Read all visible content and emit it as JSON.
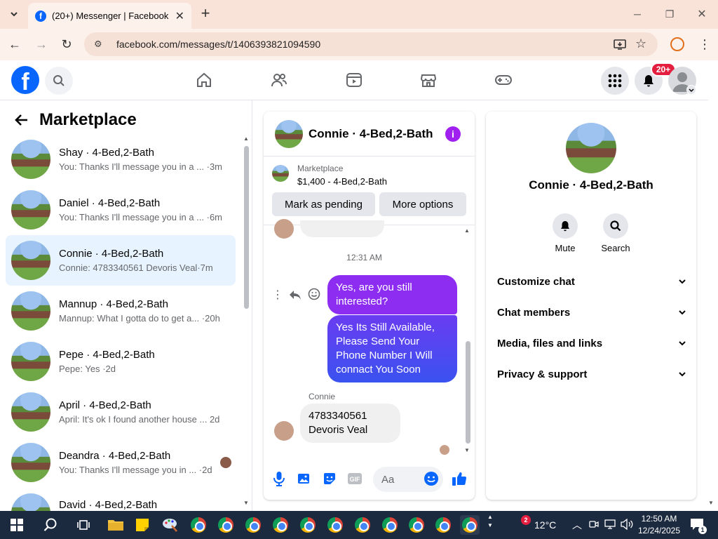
{
  "browser": {
    "tab_title": "(20+) Messenger | Facebook",
    "url": "facebook.com/messages/t/1406393821094590"
  },
  "fb_header": {
    "notif_badge": "20+"
  },
  "sidebar": {
    "title": "Marketplace",
    "conversations": [
      {
        "name": "Shay · 4-Bed,2-Bath",
        "preview": "You: Thanks I'll message you in a ...",
        "time": "·3m"
      },
      {
        "name": "Daniel · 4-Bed,2-Bath",
        "preview": "You: Thanks I'll message you in a ...",
        "time": "·6m"
      },
      {
        "name": "Connie · 4-Bed,2-Bath",
        "preview": "Connie: 4783340561 Devoris Veal",
        "time": "·7m",
        "active": true
      },
      {
        "name": "Mannup · 4-Bed,2-Bath",
        "preview": "Mannup: What I gotta do to get a...",
        "time": "·20h"
      },
      {
        "name": "Pepe · 4-Bed,2-Bath",
        "preview": "Pepe: Yes",
        "time": "·2d"
      },
      {
        "name": "April · 4-Bed,2-Bath",
        "preview": "April: It's ok I found another house ...",
        "time": "2d"
      },
      {
        "name": "Deandra · 4-Bed,2-Bath",
        "preview": "You: Thanks I'll message you in ...",
        "time": "·2d"
      },
      {
        "name": "David · 4-Bed,2-Bath",
        "preview": "",
        "time": ""
      }
    ]
  },
  "chat": {
    "title": "Connie · 4-Bed,2-Bath",
    "marketplace_label": "Marketplace",
    "listing": "$1,400 - 4-Bed,2-Bath",
    "mark_pending": "Mark as pending",
    "more_options": "More options",
    "timestamp": "12:31 AM",
    "msg_out_1": "Yes, are you still interested?",
    "msg_out_2": "Yes Its Still Available, Please Send Your Phone Number I Will connact You Soon",
    "sender": "Connie",
    "msg_in_1": "4783340561 Devoris Veal",
    "composer_placeholder": "Aa"
  },
  "info": {
    "name": "Connie · 4-Bed,2-Bath",
    "mute": "Mute",
    "search": "Search",
    "rows": [
      "Customize chat",
      "Chat members",
      "Media, files and links",
      "Privacy & support"
    ]
  },
  "taskbar": {
    "weather_badge": "2",
    "temperature": "12°C",
    "time": "12:50 AM",
    "date": "12/24/2025",
    "notif_count": "1"
  },
  "colors": {
    "fb_blue": "#0866ff",
    "messenger_gradient_top": "#8d2df2",
    "messenger_gradient_bottom": "#3a52f0",
    "active_row": "#e7f3ff",
    "badge_red": "#e41e3f"
  }
}
